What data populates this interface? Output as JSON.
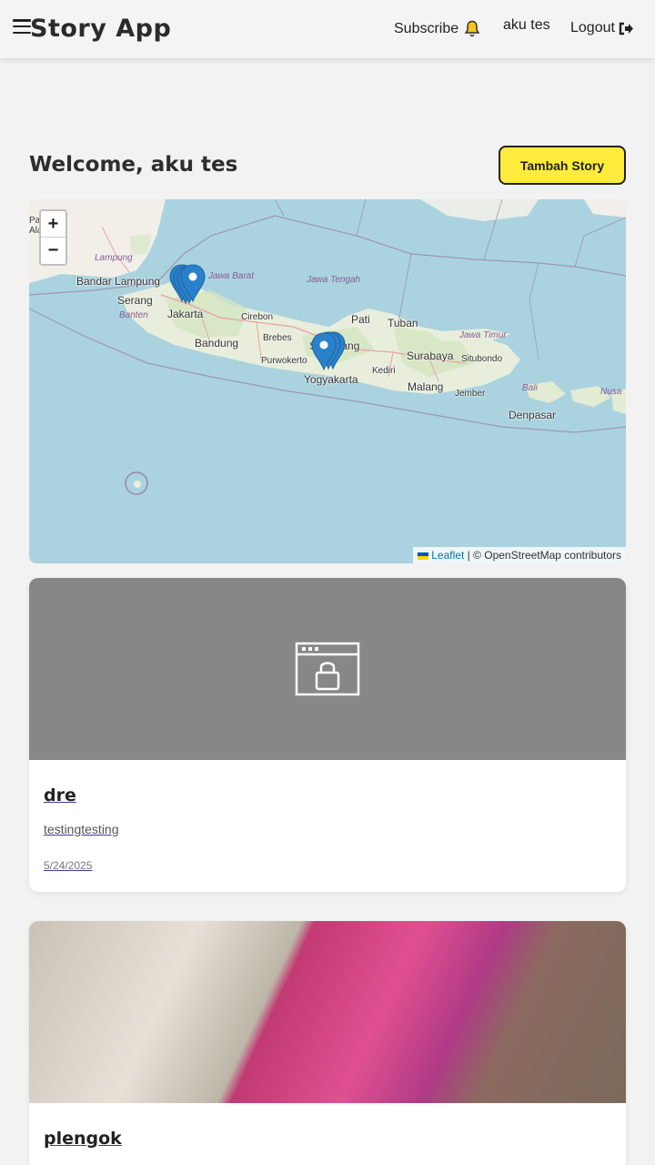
{
  "header": {
    "brand": "Story App",
    "subscribe": "Subscribe",
    "user": "aku tes",
    "logout": "Logout",
    "bell_icon": "bell-icon",
    "logout_icon": "sign-out-icon"
  },
  "main": {
    "welcome": "Welcome, aku tes",
    "add_button": "Tambah Story"
  },
  "map": {
    "zoom_in": "+",
    "zoom_out": "−",
    "attribution_link": "Leaflet",
    "attribution_text": "| © OpenStreetMap contributors",
    "labels": {
      "lampung": "Lampung",
      "bandar_lampung": "Bandar Lampung",
      "serang": "Serang",
      "banten": "Banten",
      "jakarta": "Jakarta",
      "jawa_barat": "Jawa Barat",
      "jawa_tengah": "Jawa Tengah",
      "jawa_timur": "Jawa Timur",
      "cirebon": "Cirebon",
      "bandung": "Bandung",
      "brebes": "Brebes",
      "purwokerto": "Purwokerto",
      "semarang": "Semarang",
      "pati": "Pati",
      "tuban": "Tuban",
      "surabaya": "Surabaya",
      "situbondo": "Situbondo",
      "yogyakarta": "Yogyakarta",
      "kediri": "Kediri",
      "malang": "Malang",
      "jember": "Jember",
      "bali": "Bali",
      "denpasar": "Denpasar",
      "nusa": "Nusa",
      "pag": "Pag",
      "ala": "Ala"
    }
  },
  "stories": [
    {
      "title": "dre",
      "description": "testingtesting",
      "date": "5/24/2025",
      "image": "placeholder-locked"
    },
    {
      "title": "plengok",
      "description": "",
      "date": "",
      "image": "photo"
    }
  ]
}
